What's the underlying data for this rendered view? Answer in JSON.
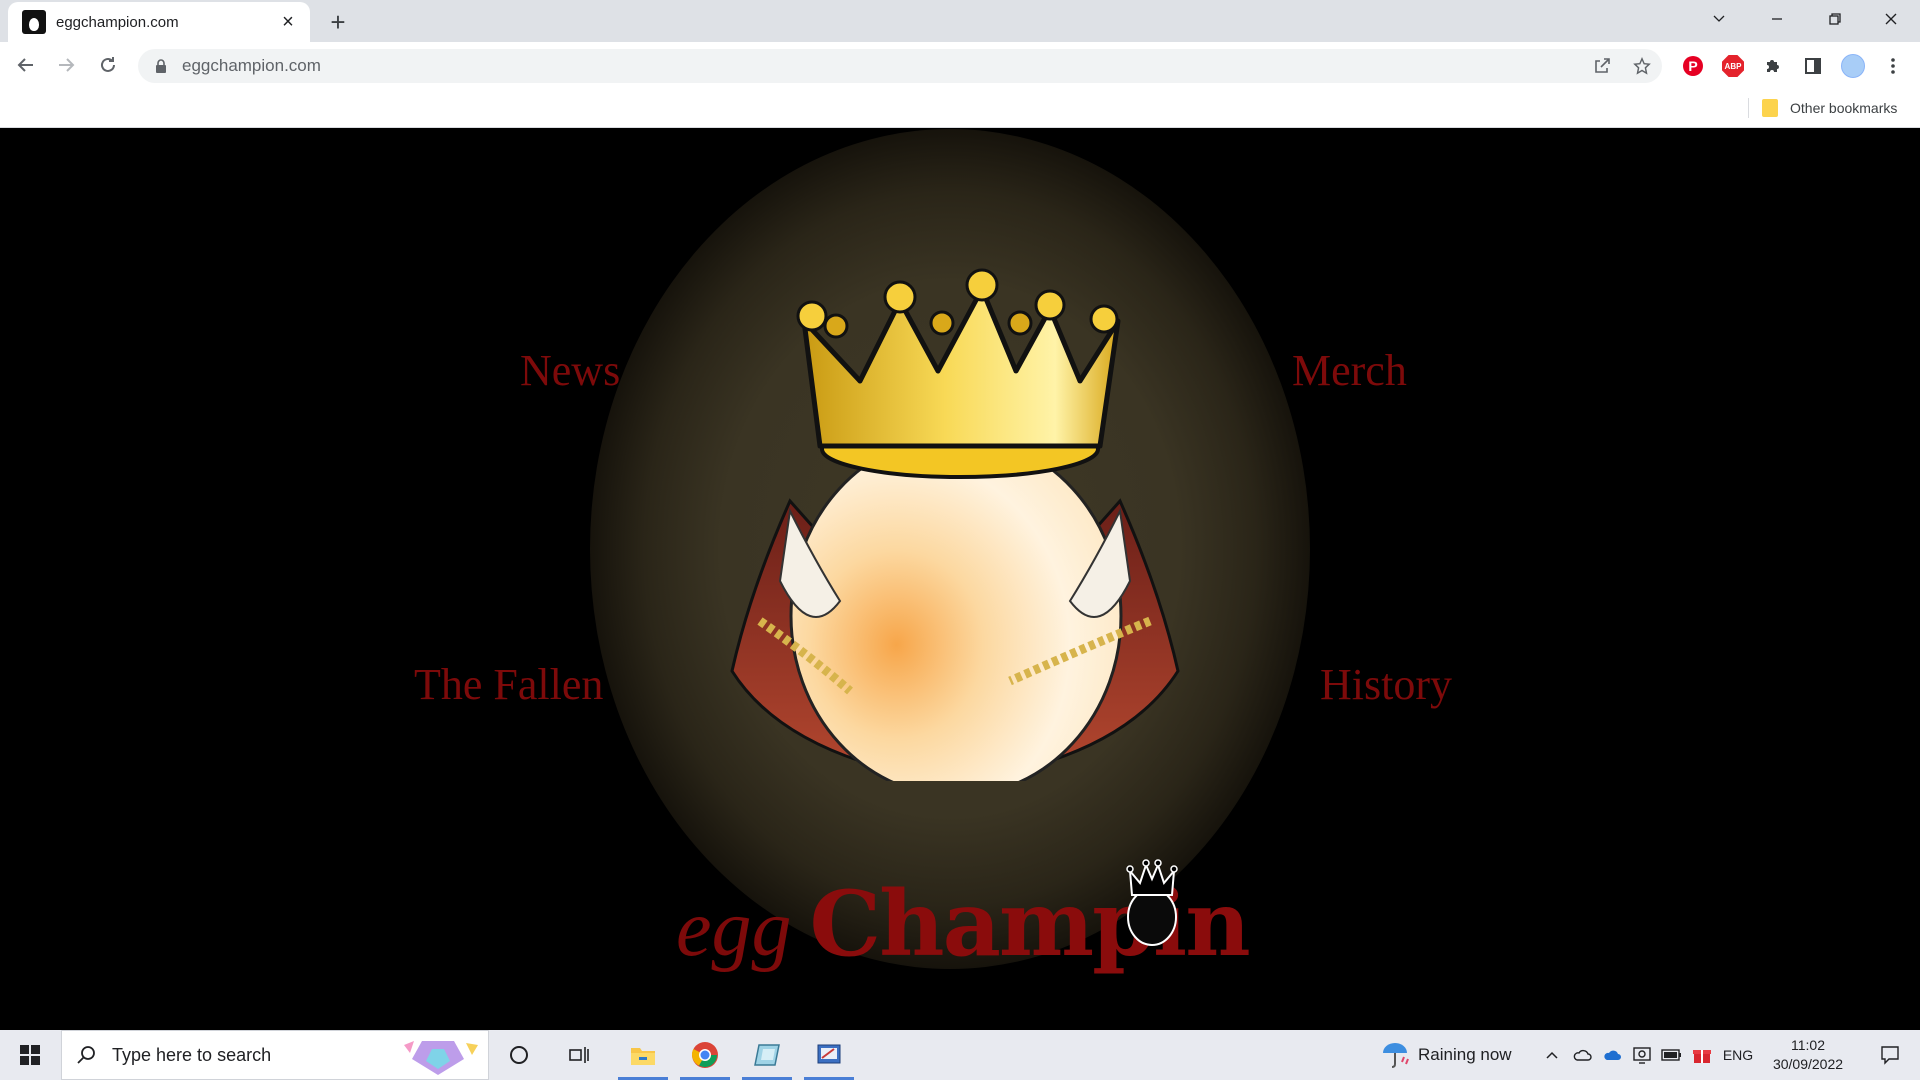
{
  "browser": {
    "tab": {
      "title": "eggchampion.com",
      "close_glyph": "×"
    },
    "new_tab_glyph": "+",
    "address": {
      "url": "eggchampion.com"
    },
    "bookmarks_bar": {
      "other_bookmarks": "Other bookmarks"
    },
    "extensions": [
      "pinterest-icon",
      "adblock-plus-icon",
      "puzzle-extensions-icon",
      "side-panel-icon",
      "profile-avatar"
    ],
    "abp_label": "ABP",
    "pin_label": "P"
  },
  "site": {
    "nav": {
      "news": "News",
      "merch": "Merch",
      "fallen": "The Fallen",
      "history": "History"
    },
    "logo": {
      "egg": "egg",
      "champion": "Champi",
      "champion_tail": "n"
    },
    "colors": {
      "link": "#7d0a0a",
      "background": "#000000",
      "glow": "#3e3826",
      "crown": "#f3c624"
    }
  },
  "taskbar": {
    "search_placeholder": "Type here to search",
    "weather": "Raining now",
    "language": "ENG",
    "time": "11:02",
    "date": "30/09/2022",
    "pinned": [
      "task-view-icon",
      "file-explorer-icon",
      "chrome-icon",
      "app-icon",
      "app-icon-2"
    ]
  }
}
